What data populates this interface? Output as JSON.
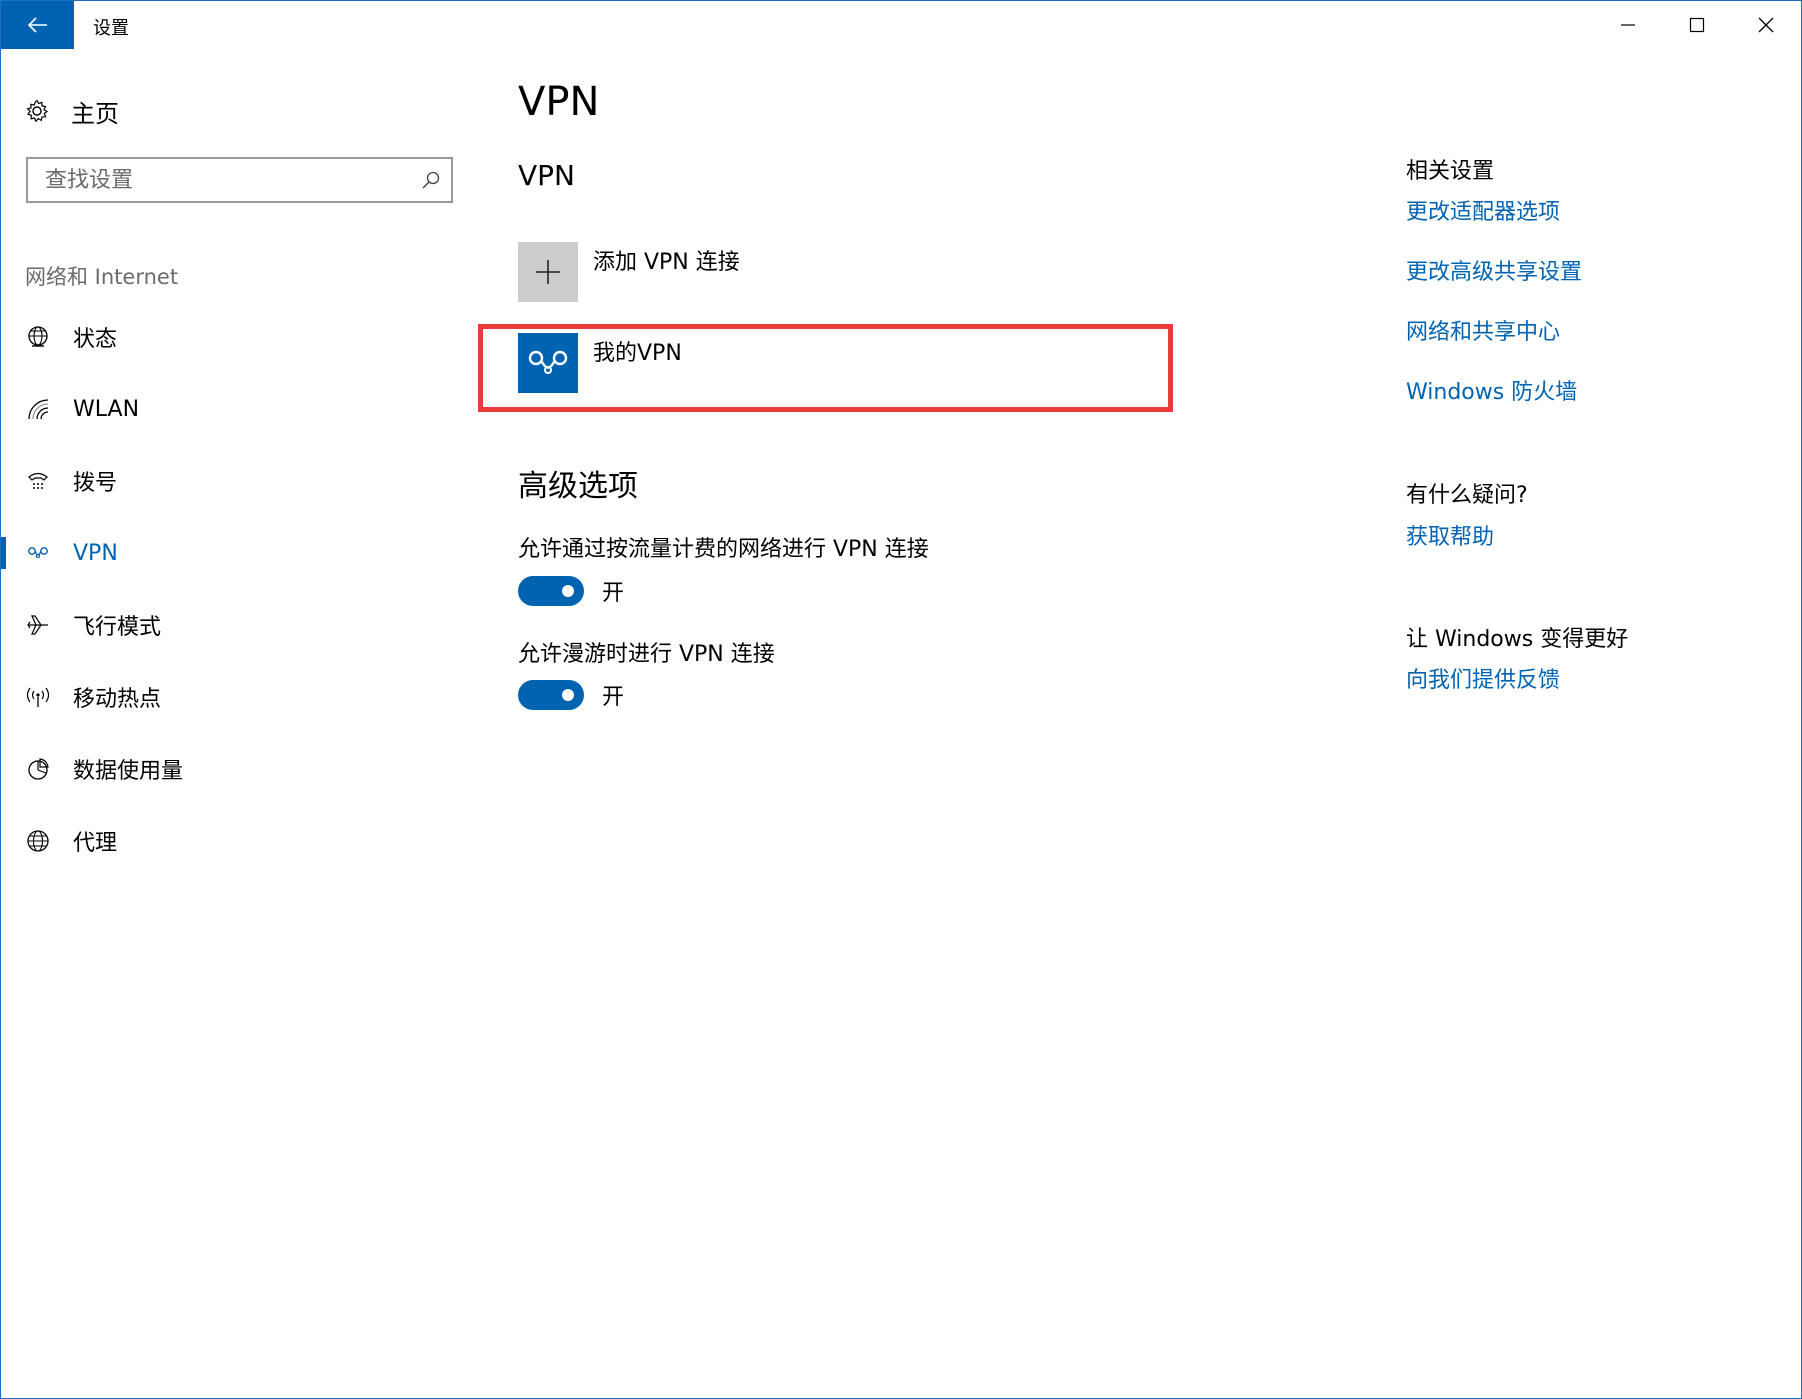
{
  "window": {
    "title": "设置",
    "accent": "#0063b1"
  },
  "sidebar": {
    "home_label": "主页",
    "search_placeholder": "查找设置",
    "section_label": "网络和 Internet",
    "items": [
      {
        "label": "状态",
        "icon": "globe-status-icon"
      },
      {
        "label": "WLAN",
        "icon": "wifi-icon"
      },
      {
        "label": "拨号",
        "icon": "dialup-icon"
      },
      {
        "label": "VPN",
        "icon": "vpn-icon",
        "active": true
      },
      {
        "label": "飞行模式",
        "icon": "airplane-icon"
      },
      {
        "label": "移动热点",
        "icon": "hotspot-icon"
      },
      {
        "label": "数据使用量",
        "icon": "data-usage-icon"
      },
      {
        "label": "代理",
        "icon": "globe-icon"
      }
    ]
  },
  "main": {
    "page_title": "VPN",
    "vpn_section_title": "VPN",
    "add_vpn_label": "添加 VPN 连接",
    "vpn_connection_name": "我的VPN",
    "advanced_title": "高级选项",
    "options": [
      {
        "label": "允许通过按流量计费的网络进行 VPN 连接",
        "state": "开",
        "on": true
      },
      {
        "label": "允许漫游时进行 VPN 连接",
        "state": "开",
        "on": true
      }
    ],
    "highlight_color": "#e83b3b"
  },
  "related": {
    "heading": "相关设置",
    "links": [
      "更改适配器选项",
      "更改高级共享设置",
      "网络和共享中心",
      "Windows 防火墙"
    ],
    "question_heading": "有什么疑问?",
    "help_link": "获取帮助",
    "feedback_heading": "让 Windows 变得更好",
    "feedback_link": "向我们提供反馈"
  }
}
